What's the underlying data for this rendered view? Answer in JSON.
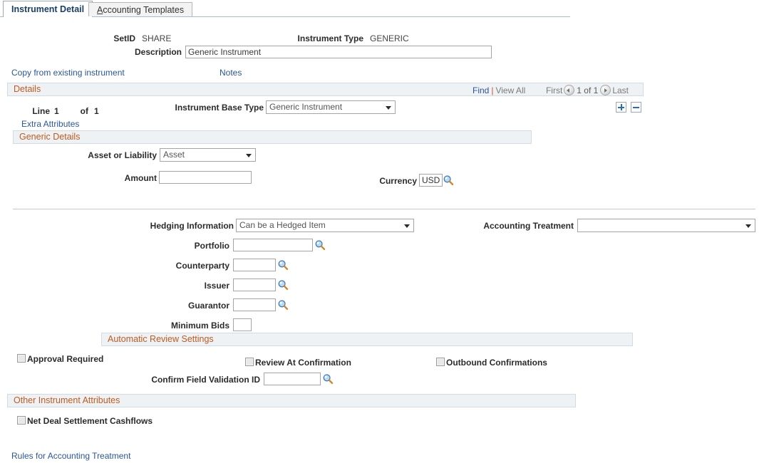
{
  "tabs": [
    {
      "label": "Instrument Detail",
      "accesskey": "",
      "active": true
    },
    {
      "label": "Accounting Templates",
      "accesskey": "A",
      "active": false
    }
  ],
  "header": {
    "setid_label": "SetID",
    "setid_value": "SHARE",
    "instrument_type_label": "Instrument Type",
    "instrument_type_value": "GENERIC",
    "description_label": "Description",
    "description_value": "Generic Instrument"
  },
  "top_links": {
    "copy_from_existing": "Copy from existing instrument",
    "notes": "Notes"
  },
  "details_section": {
    "title": "Details",
    "nav": {
      "find": "Find",
      "separator": "|",
      "view_all": "View All",
      "first": "First",
      "counter": "1 of 1",
      "last": "Last"
    },
    "line_label": "Line",
    "line_number": "1",
    "of_label": "of",
    "of_number": "1",
    "extra_attributes_link": "Extra Attributes",
    "instrument_base_type_label": "Instrument Base Type",
    "instrument_base_type_value": "Generic Instrument",
    "add_row_title": "Add a new row",
    "delete_row_title": "Delete row"
  },
  "generic_details": {
    "title": "Generic Details",
    "asset_or_liability_label": "Asset or Liability",
    "asset_or_liability_value": "Asset",
    "amount_label": "Amount",
    "amount_value": "",
    "currency_label": "Currency",
    "currency_value": "USD"
  },
  "hedging": {
    "hedging_information_label": "Hedging Information",
    "hedging_information_value": "Can be a Hedged Item",
    "accounting_treatment_label": "Accounting Treatment",
    "accounting_treatment_value": "",
    "portfolio_label": "Portfolio",
    "portfolio_value": "",
    "counterparty_label": "Counterparty",
    "counterparty_value": "",
    "issuer_label": "Issuer",
    "issuer_value": "",
    "guarantor_label": "Guarantor",
    "guarantor_value": "",
    "minimum_bids_label": "Minimum Bids",
    "minimum_bids_value": ""
  },
  "automatic_review": {
    "title": "Automatic Review Settings",
    "approval_required_label": "Approval Required",
    "review_at_confirmation_label": "Review At Confirmation",
    "outbound_confirmations_label": "Outbound Confirmations",
    "confirm_field_validation_label": "Confirm Field Validation ID",
    "confirm_field_validation_value": ""
  },
  "other_attributes": {
    "title": "Other Instrument Attributes",
    "net_deal_settlement_label": "Net Deal Settlement Cashflows"
  },
  "footer": {
    "rules_link": "Rules for Accounting Treatment"
  },
  "icons": {
    "lookup": "magnifying-glass-lookup-icon"
  },
  "colors": {
    "section_title": "#c05a1e",
    "link": "#2a5699",
    "section_bar_bg": "#eef2f5",
    "active_tab_text": "#1a3f66",
    "row_button_glyph": "#2f6bb0"
  }
}
